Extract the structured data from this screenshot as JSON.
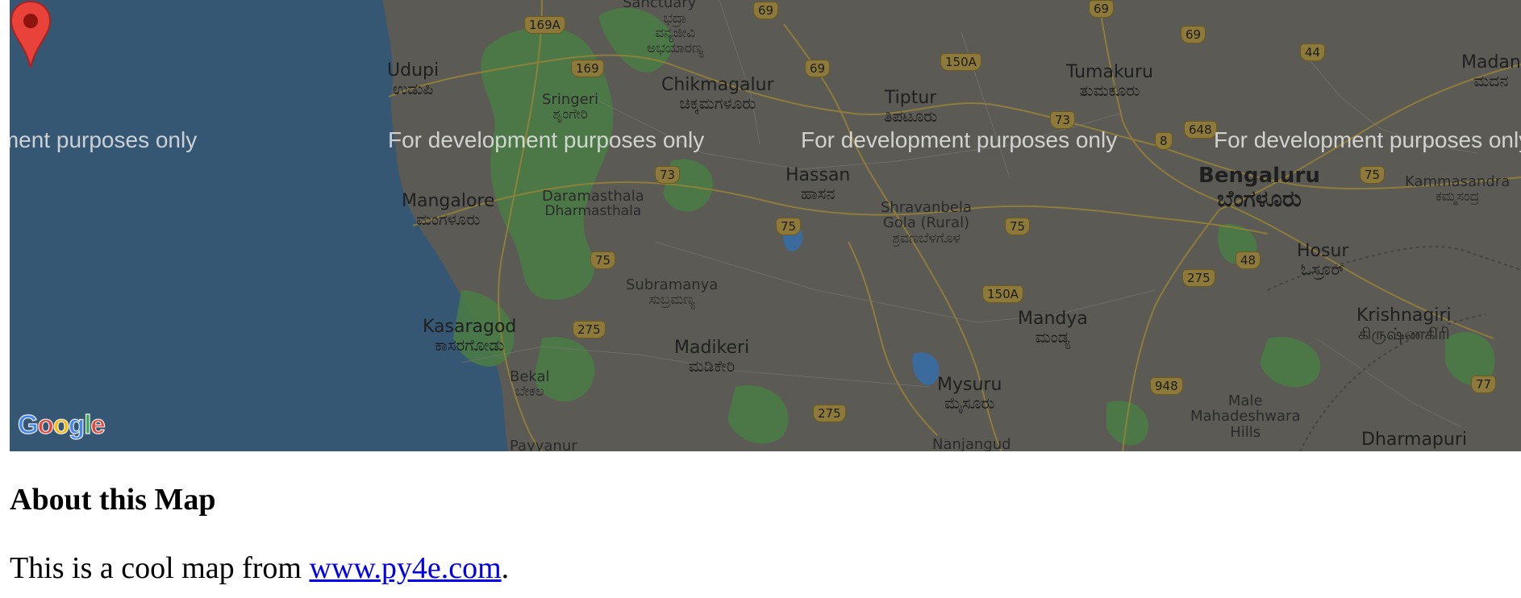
{
  "map": {
    "watermark_text": "For development purposes only",
    "logo_text": "Google",
    "logo_colors": [
      "#4285f4",
      "#ea4335",
      "#fbbc05",
      "#4285f4",
      "#34a853",
      "#ea4335"
    ],
    "sea_color": "#355774",
    "land_color": "#5b5a55",
    "marker_color": "#e8423a",
    "places": {
      "sanctuary": {
        "name": "Sanctuary"
      },
      "bhadra": {
        "name": "ಭದ್ರಾ",
        "name2": "ವನ್ಯಜೀವಿ",
        "name3": "ಅಭಯಾರಣ್ಯ"
      },
      "udupi": {
        "name": "Udupi",
        "kn": "ಉಡುಪಿ"
      },
      "sringeri": {
        "name": "Sringeri",
        "kn": "ಶೃಂಗೇರಿ"
      },
      "chikmagalur": {
        "name": "Chikmagalur",
        "kn": "ಚಿಕ್ಕಮಗಳೂರು"
      },
      "tiptur": {
        "name": "Tiptur",
        "kn": "ತಿಪಟೂರು"
      },
      "tumakuru": {
        "name": "Tumakuru",
        "kn": "ತುಮಕೂರು"
      },
      "madanapalle": {
        "name": "Madan",
        "kn": "ಮದನ"
      },
      "mangalore": {
        "name": "Mangalore",
        "kn": "ಮಂಗಳೂರು"
      },
      "dharmasthala": {
        "name": "Daramasthala",
        "kn": "Dharmasthala"
      },
      "hassan": {
        "name": "Hassan",
        "kn": "ಹಾಸನ"
      },
      "shravanabela": {
        "name": "Shravanbela",
        "name2": "Gola (Rural)",
        "kn": "ಶ್ರವಣಬೆಳಗೊಳ"
      },
      "bengaluru": {
        "name": "Bengaluru",
        "kn": "ಬೆಂಗಳೂರು"
      },
      "kammasandra": {
        "name": "Kammasandra",
        "kn": "ಕಮ್ಮಸಂದ್ರ"
      },
      "hosur": {
        "name": "Hosur",
        "kn": "ಓಸ್ರೂರ್"
      },
      "subramanya": {
        "name": "Subramanya",
        "kn": "ಸುಬ್ರಮಣ್ಯ"
      },
      "kasaragod": {
        "name": "Kasaragod",
        "kn": "ಕಾಸರಗೋಡು"
      },
      "bekal": {
        "name": "Bekal",
        "kn": "ಬೇಕಲ"
      },
      "payyanur": {
        "name": "Payyanur"
      },
      "madikeri": {
        "name": "Madikeri",
        "kn": "ಮಡಿಕೇರಿ"
      },
      "mandya": {
        "name": "Mandya",
        "kn": "ಮಂಡ್ಯ"
      },
      "krishnagiri": {
        "name": "Krishnagiri",
        "kn": "கிருஷ்ணகிரி"
      },
      "mysuru": {
        "name": "Mysuru",
        "kn": "ಮೈಸೂರು"
      },
      "nanjangud": {
        "name": "Nanjangud"
      },
      "male_mahadeshwara": {
        "name": "Male",
        "name2": "Mahadeshwara",
        "name3": "Hills"
      },
      "dharmapuri": {
        "name": "Dharmapuri"
      }
    },
    "shields": [
      "169A",
      "69",
      "69",
      "69",
      "44",
      "169",
      "69",
      "150A",
      "73",
      "648",
      "8",
      "73",
      "75",
      "75",
      "75",
      "75",
      "150A",
      "48",
      "275",
      "275",
      "275",
      "948",
      "77"
    ]
  },
  "about": {
    "heading": "About this Map",
    "text_before": "This is a cool map from ",
    "link_text": "www.py4e.com",
    "text_after": "."
  }
}
